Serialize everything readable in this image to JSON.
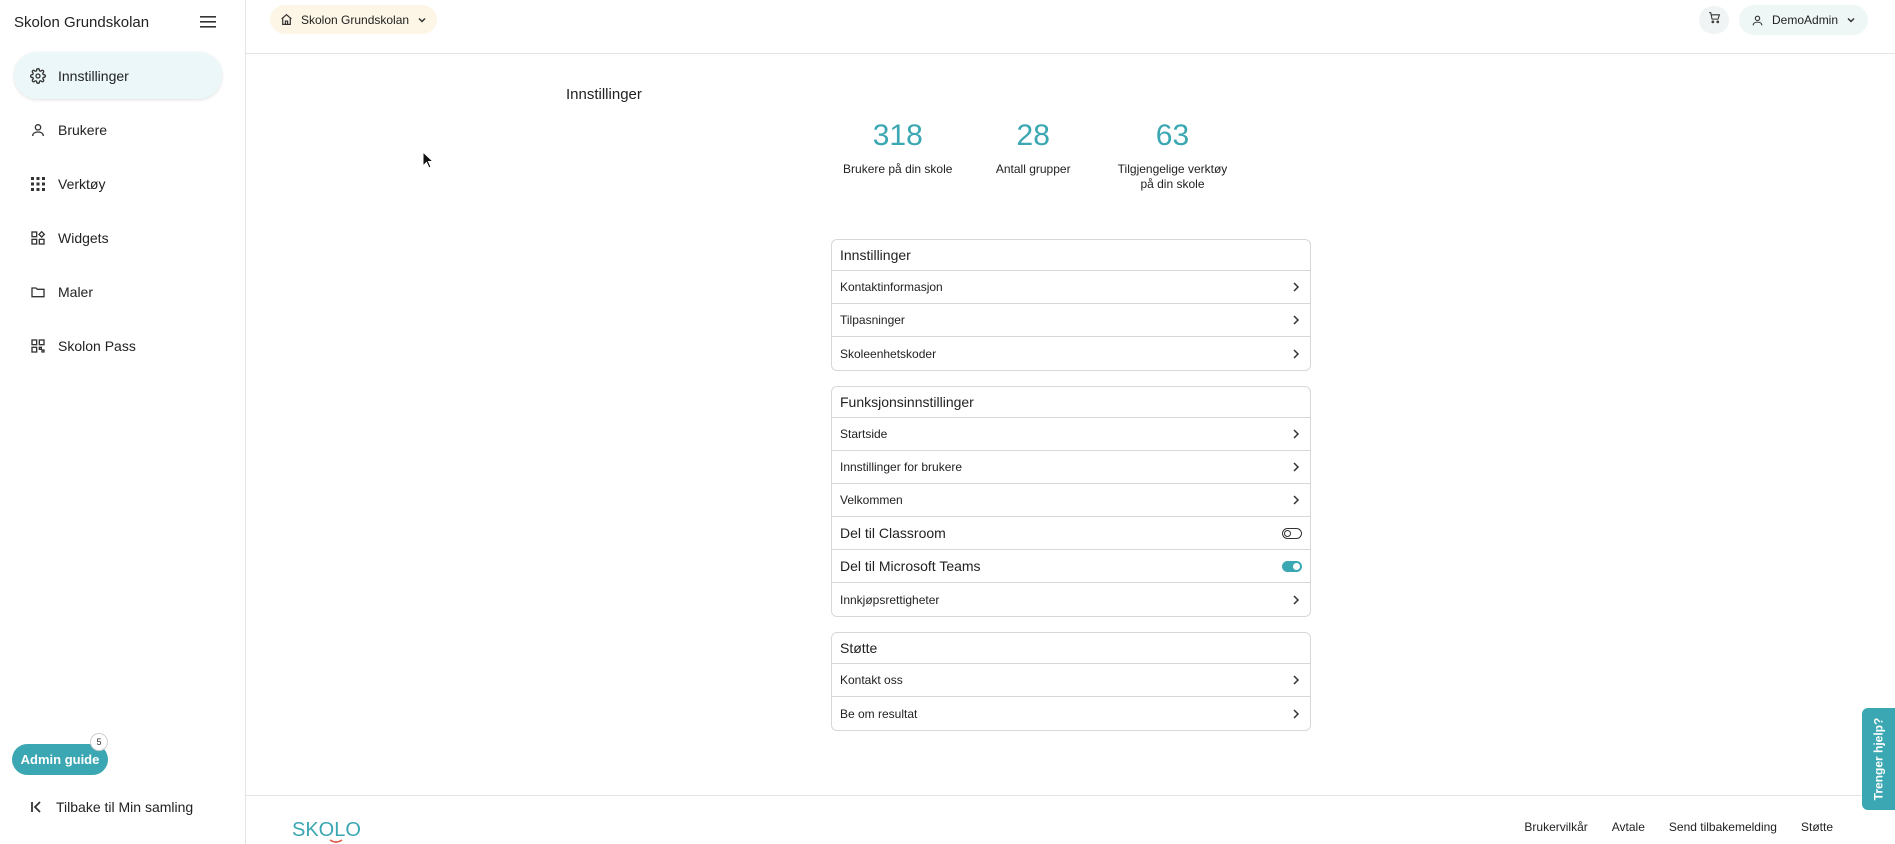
{
  "sidebar": {
    "title": "Skolon Grundskolan",
    "items": [
      {
        "label": "Innstillinger",
        "icon": "gear-icon",
        "active": true
      },
      {
        "label": "Brukere",
        "icon": "person-icon"
      },
      {
        "label": "Verktøy",
        "icon": "grid-icon"
      },
      {
        "label": "Widgets",
        "icon": "widgets-icon"
      },
      {
        "label": "Maler",
        "icon": "folder-icon"
      },
      {
        "label": "Skolon Pass",
        "icon": "qr-icon"
      }
    ],
    "admin_guide": "Admin guide",
    "admin_guide_badge": "5",
    "back_label": "Tilbake til Min samling"
  },
  "topbar": {
    "school": "Skolon Grundskolan",
    "user": "DemoAdmin"
  },
  "main": {
    "title": "Innstillinger",
    "stats": [
      {
        "value": "318",
        "label": "Brukere på din skole"
      },
      {
        "value": "28",
        "label": "Antall grupper"
      },
      {
        "value": "63",
        "label": "Tilgjengelige verktøy på din skole"
      }
    ],
    "cards": [
      {
        "title": "Innstillinger",
        "rows": [
          "Kontaktinformasjon",
          "Tilpasninger",
          "Skoleenhetskoder"
        ]
      },
      {
        "title": "Funksjonsinnstillinger",
        "rows": [
          "Startside",
          "Innstillinger for brukere",
          "Velkommen",
          "Del til Classroom",
          "Del til Microsoft Teams",
          "Innkjøpsrettigheter"
        ]
      },
      {
        "title": "Støtte",
        "rows": [
          "Kontakt oss",
          "Be om resultat"
        ]
      }
    ]
  },
  "footer": {
    "logo_text": "SKOLON",
    "links": [
      "Brukervilkår",
      "Avtale",
      "Send tilbakemelding",
      "Støtte"
    ]
  },
  "help_tab": "Trenger hjelp?",
  "colors": {
    "accent": "#3aa7b2",
    "active_bg": "#ebf7f8",
    "school_pill": "#fdf6e6"
  }
}
